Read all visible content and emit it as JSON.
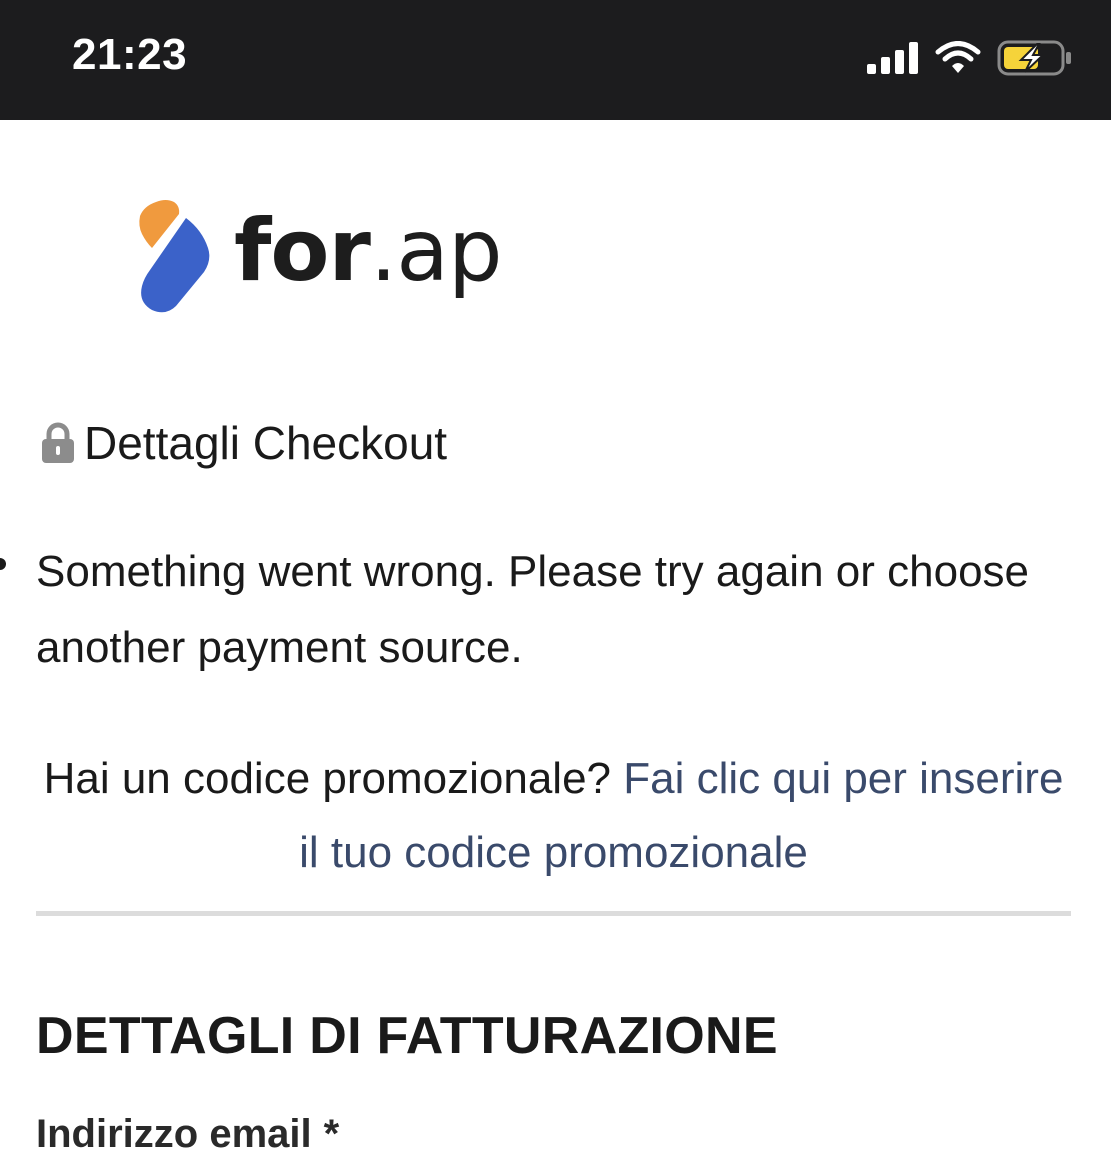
{
  "status_bar": {
    "time": "21:23",
    "icons": [
      "signal-icon",
      "wifi-icon",
      "battery-charging-icon"
    ],
    "battery_color": "#f5d33a"
  },
  "logo": {
    "text_bold": "for",
    "text_light": ".ap",
    "colors": {
      "orange": "#f09a3e",
      "blue": "#3b62c9"
    }
  },
  "checkout": {
    "title": "Dettagli Checkout",
    "icon": "lock-icon"
  },
  "error": {
    "message": "Something went wrong. Please try again or choose another payment source."
  },
  "promo": {
    "question": "Hai un codice promozionale?",
    "link": "Fai clic qui per inserire il tuo codice promozionale",
    "link_color": "#3a4a6b"
  },
  "billing": {
    "title": "DETTAGLI DI FATTURAZIONE",
    "email_label": "Indirizzo email",
    "required_marker": "*"
  }
}
